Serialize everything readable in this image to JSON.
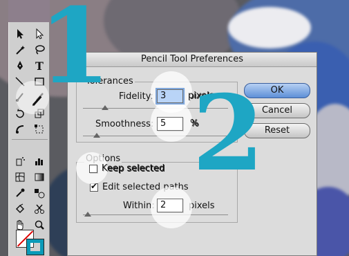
{
  "dialog": {
    "title": "Pencil Tool Preferences",
    "tolerances": {
      "legend": "Tolerances",
      "fidelity_label": "Fidelity:",
      "fidelity_value": "3",
      "fidelity_unit": "pixels",
      "smoothness_label": "Smoothness:",
      "smoothness_value": "5",
      "smoothness_unit": "%"
    },
    "options": {
      "legend": "Options",
      "keep_selected_label": "Keep selected",
      "keep_selected_checked": false,
      "edit_paths_label": "Edit selected paths",
      "edit_paths_checked": true,
      "within_label": "Within:",
      "within_value": "2",
      "within_unit": "pixels"
    },
    "buttons": {
      "ok": "OK",
      "cancel": "Cancel",
      "reset": "Reset"
    }
  },
  "annotations": {
    "step1": "1",
    "step2": "2"
  },
  "colors": {
    "annotation": "#1ea6c4",
    "stroke_swatch": "#0a9ab8"
  }
}
